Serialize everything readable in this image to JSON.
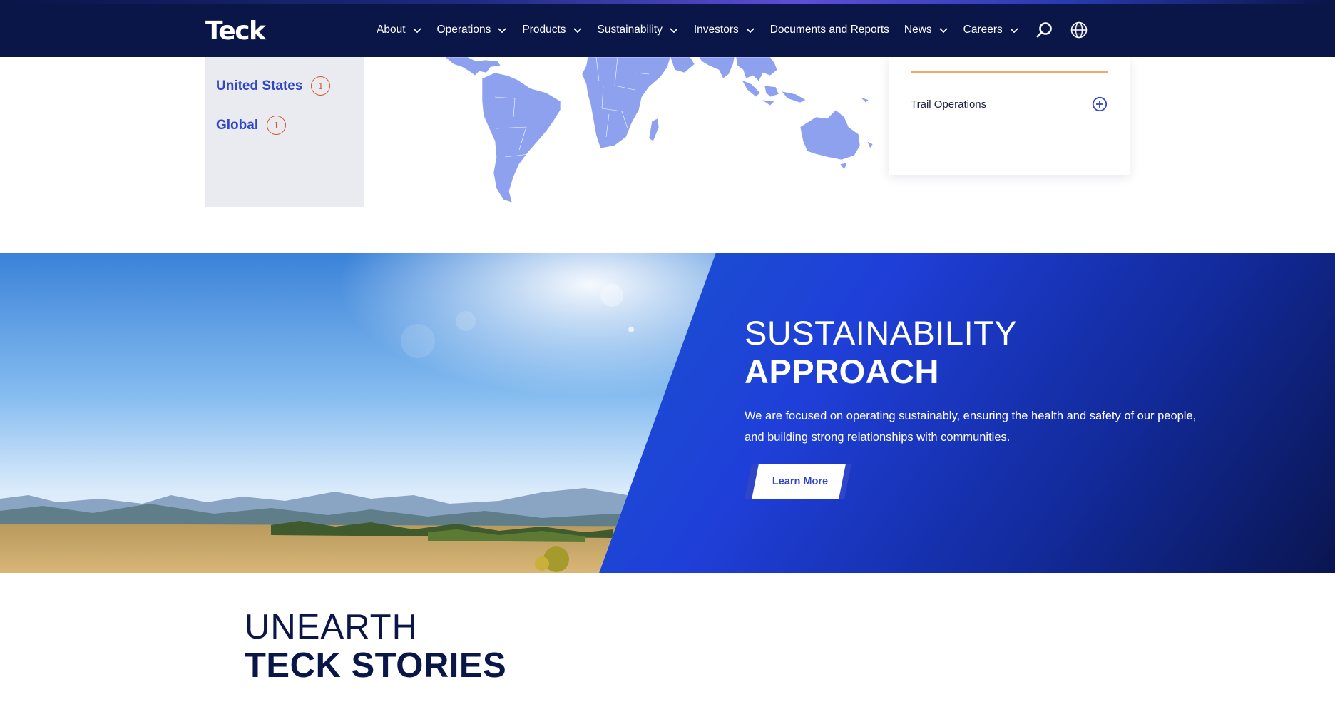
{
  "header": {
    "logo": "Teck",
    "nav": [
      {
        "label": "About"
      },
      {
        "label": "Operations"
      },
      {
        "label": "Products"
      },
      {
        "label": "Sustainability"
      },
      {
        "label": "Investors"
      },
      {
        "label": "Documents and Reports"
      },
      {
        "label": "News"
      },
      {
        "label": "Careers"
      }
    ],
    "icons": [
      "search-icon",
      "globe-icon"
    ]
  },
  "map_section": {
    "countries": [
      {
        "name": "United States",
        "count": "1"
      },
      {
        "name": "Global",
        "count": "1"
      }
    ],
    "operations": [
      {
        "label": "Trail Operations"
      }
    ],
    "colors": {
      "accent": "#2f46c8",
      "badge": "#d2552b",
      "map_fill": "#8da1ee",
      "divider": "#f4a66b"
    }
  },
  "sustainability": {
    "title_light": "SUSTAINABILITY",
    "title_bold": "APPROACH",
    "body": "We are focused on operating sustainably, ensuring the health and safety of our people, and building strong relationships with communities.",
    "cta": "Learn More"
  },
  "stories": {
    "title_light": "UNEARTH",
    "title_bold": "TECK STORIES"
  }
}
